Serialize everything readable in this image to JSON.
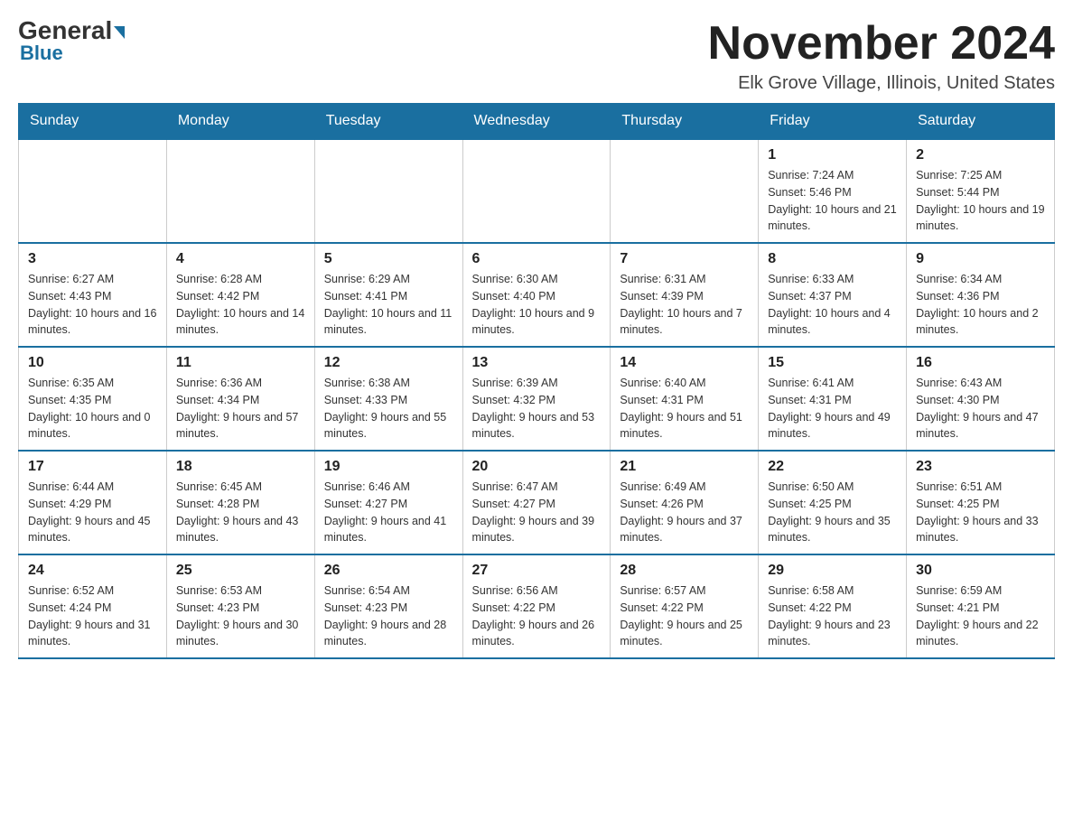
{
  "logo": {
    "general": "General",
    "blue": "Blue"
  },
  "header": {
    "month": "November 2024",
    "location": "Elk Grove Village, Illinois, United States"
  },
  "days_of_week": [
    "Sunday",
    "Monday",
    "Tuesday",
    "Wednesday",
    "Thursday",
    "Friday",
    "Saturday"
  ],
  "weeks": [
    [
      {
        "day": "",
        "sunrise": "",
        "sunset": "",
        "daylight": ""
      },
      {
        "day": "",
        "sunrise": "",
        "sunset": "",
        "daylight": ""
      },
      {
        "day": "",
        "sunrise": "",
        "sunset": "",
        "daylight": ""
      },
      {
        "day": "",
        "sunrise": "",
        "sunset": "",
        "daylight": ""
      },
      {
        "day": "",
        "sunrise": "",
        "sunset": "",
        "daylight": ""
      },
      {
        "day": "1",
        "sunrise": "Sunrise: 7:24 AM",
        "sunset": "Sunset: 5:46 PM",
        "daylight": "Daylight: 10 hours and 21 minutes."
      },
      {
        "day": "2",
        "sunrise": "Sunrise: 7:25 AM",
        "sunset": "Sunset: 5:44 PM",
        "daylight": "Daylight: 10 hours and 19 minutes."
      }
    ],
    [
      {
        "day": "3",
        "sunrise": "Sunrise: 6:27 AM",
        "sunset": "Sunset: 4:43 PM",
        "daylight": "Daylight: 10 hours and 16 minutes."
      },
      {
        "day": "4",
        "sunrise": "Sunrise: 6:28 AM",
        "sunset": "Sunset: 4:42 PM",
        "daylight": "Daylight: 10 hours and 14 minutes."
      },
      {
        "day": "5",
        "sunrise": "Sunrise: 6:29 AM",
        "sunset": "Sunset: 4:41 PM",
        "daylight": "Daylight: 10 hours and 11 minutes."
      },
      {
        "day": "6",
        "sunrise": "Sunrise: 6:30 AM",
        "sunset": "Sunset: 4:40 PM",
        "daylight": "Daylight: 10 hours and 9 minutes."
      },
      {
        "day": "7",
        "sunrise": "Sunrise: 6:31 AM",
        "sunset": "Sunset: 4:39 PM",
        "daylight": "Daylight: 10 hours and 7 minutes."
      },
      {
        "day": "8",
        "sunrise": "Sunrise: 6:33 AM",
        "sunset": "Sunset: 4:37 PM",
        "daylight": "Daylight: 10 hours and 4 minutes."
      },
      {
        "day": "9",
        "sunrise": "Sunrise: 6:34 AM",
        "sunset": "Sunset: 4:36 PM",
        "daylight": "Daylight: 10 hours and 2 minutes."
      }
    ],
    [
      {
        "day": "10",
        "sunrise": "Sunrise: 6:35 AM",
        "sunset": "Sunset: 4:35 PM",
        "daylight": "Daylight: 10 hours and 0 minutes."
      },
      {
        "day": "11",
        "sunrise": "Sunrise: 6:36 AM",
        "sunset": "Sunset: 4:34 PM",
        "daylight": "Daylight: 9 hours and 57 minutes."
      },
      {
        "day": "12",
        "sunrise": "Sunrise: 6:38 AM",
        "sunset": "Sunset: 4:33 PM",
        "daylight": "Daylight: 9 hours and 55 minutes."
      },
      {
        "day": "13",
        "sunrise": "Sunrise: 6:39 AM",
        "sunset": "Sunset: 4:32 PM",
        "daylight": "Daylight: 9 hours and 53 minutes."
      },
      {
        "day": "14",
        "sunrise": "Sunrise: 6:40 AM",
        "sunset": "Sunset: 4:31 PM",
        "daylight": "Daylight: 9 hours and 51 minutes."
      },
      {
        "day": "15",
        "sunrise": "Sunrise: 6:41 AM",
        "sunset": "Sunset: 4:31 PM",
        "daylight": "Daylight: 9 hours and 49 minutes."
      },
      {
        "day": "16",
        "sunrise": "Sunrise: 6:43 AM",
        "sunset": "Sunset: 4:30 PM",
        "daylight": "Daylight: 9 hours and 47 minutes."
      }
    ],
    [
      {
        "day": "17",
        "sunrise": "Sunrise: 6:44 AM",
        "sunset": "Sunset: 4:29 PM",
        "daylight": "Daylight: 9 hours and 45 minutes."
      },
      {
        "day": "18",
        "sunrise": "Sunrise: 6:45 AM",
        "sunset": "Sunset: 4:28 PM",
        "daylight": "Daylight: 9 hours and 43 minutes."
      },
      {
        "day": "19",
        "sunrise": "Sunrise: 6:46 AM",
        "sunset": "Sunset: 4:27 PM",
        "daylight": "Daylight: 9 hours and 41 minutes."
      },
      {
        "day": "20",
        "sunrise": "Sunrise: 6:47 AM",
        "sunset": "Sunset: 4:27 PM",
        "daylight": "Daylight: 9 hours and 39 minutes."
      },
      {
        "day": "21",
        "sunrise": "Sunrise: 6:49 AM",
        "sunset": "Sunset: 4:26 PM",
        "daylight": "Daylight: 9 hours and 37 minutes."
      },
      {
        "day": "22",
        "sunrise": "Sunrise: 6:50 AM",
        "sunset": "Sunset: 4:25 PM",
        "daylight": "Daylight: 9 hours and 35 minutes."
      },
      {
        "day": "23",
        "sunrise": "Sunrise: 6:51 AM",
        "sunset": "Sunset: 4:25 PM",
        "daylight": "Daylight: 9 hours and 33 minutes."
      }
    ],
    [
      {
        "day": "24",
        "sunrise": "Sunrise: 6:52 AM",
        "sunset": "Sunset: 4:24 PM",
        "daylight": "Daylight: 9 hours and 31 minutes."
      },
      {
        "day": "25",
        "sunrise": "Sunrise: 6:53 AM",
        "sunset": "Sunset: 4:23 PM",
        "daylight": "Daylight: 9 hours and 30 minutes."
      },
      {
        "day": "26",
        "sunrise": "Sunrise: 6:54 AM",
        "sunset": "Sunset: 4:23 PM",
        "daylight": "Daylight: 9 hours and 28 minutes."
      },
      {
        "day": "27",
        "sunrise": "Sunrise: 6:56 AM",
        "sunset": "Sunset: 4:22 PM",
        "daylight": "Daylight: 9 hours and 26 minutes."
      },
      {
        "day": "28",
        "sunrise": "Sunrise: 6:57 AM",
        "sunset": "Sunset: 4:22 PM",
        "daylight": "Daylight: 9 hours and 25 minutes."
      },
      {
        "day": "29",
        "sunrise": "Sunrise: 6:58 AM",
        "sunset": "Sunset: 4:22 PM",
        "daylight": "Daylight: 9 hours and 23 minutes."
      },
      {
        "day": "30",
        "sunrise": "Sunrise: 6:59 AM",
        "sunset": "Sunset: 4:21 PM",
        "daylight": "Daylight: 9 hours and 22 minutes."
      }
    ]
  ]
}
